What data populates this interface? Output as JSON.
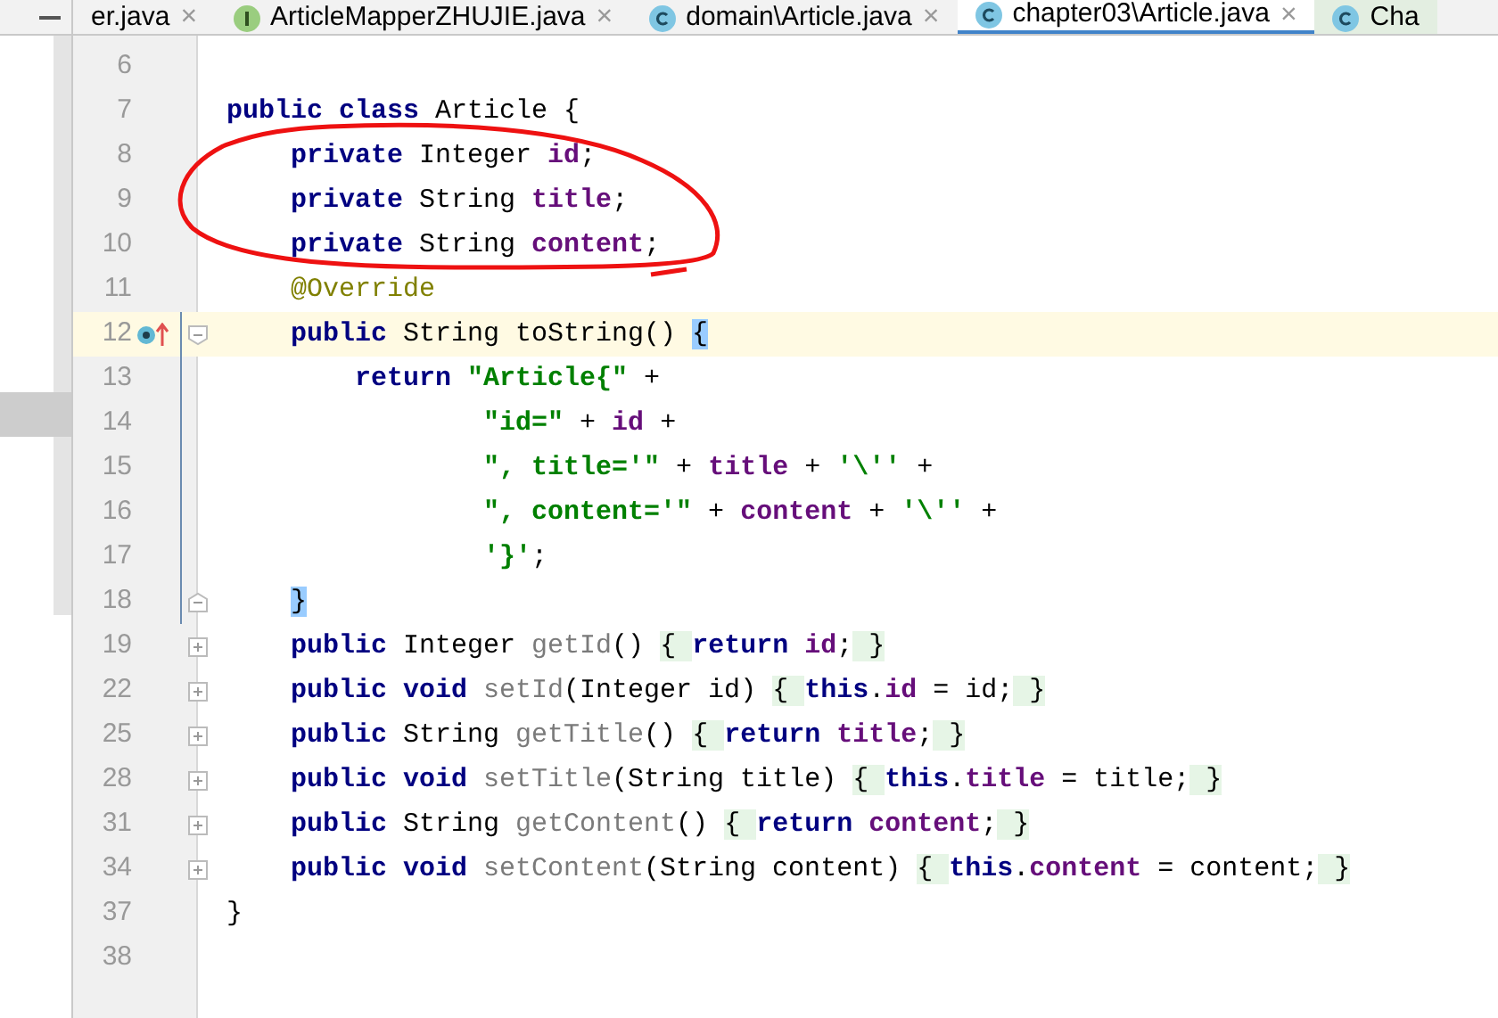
{
  "tabs": [
    {
      "label": "er.java",
      "kind": "plain",
      "selected": false,
      "close": "×"
    },
    {
      "label": "ArticleMapperZHUJIE.java",
      "kind": "interface",
      "selected": false,
      "close": "×"
    },
    {
      "label": "domain\\Article.java",
      "kind": "class",
      "selected": false,
      "close": "×"
    },
    {
      "label": "chapter03\\Article.java",
      "kind": "class",
      "selected": true,
      "close": "×"
    },
    {
      "label": "Cha",
      "kind": "class",
      "selected": false
    }
  ],
  "lines": [
    {
      "number": "6"
    },
    {
      "number": "7",
      "tokens": [
        {
          "text": "public class",
          "kind": "keyword"
        },
        {
          "text": " Article {",
          "kind": "plain"
        }
      ]
    },
    {
      "number": "8",
      "tokens": [
        {
          "text": "    private",
          "kind": "keyword"
        },
        {
          "text": " Integer ",
          "kind": "plain"
        },
        {
          "text": "id",
          "kind": "field"
        },
        {
          "text": ";",
          "kind": "plain"
        }
      ]
    },
    {
      "number": "9",
      "tokens": [
        {
          "text": "    private",
          "kind": "keyword"
        },
        {
          "text": " String ",
          "kind": "plain"
        },
        {
          "text": "title",
          "kind": "field"
        },
        {
          "text": ";",
          "kind": "plain"
        }
      ]
    },
    {
      "number": "10",
      "tokens": [
        {
          "text": "    private",
          "kind": "keyword"
        },
        {
          "text": " String ",
          "kind": "plain"
        },
        {
          "text": "content",
          "kind": "field"
        },
        {
          "text": ";",
          "kind": "plain"
        }
      ]
    },
    {
      "number": "11",
      "tokens": [
        {
          "text": "    @Override",
          "kind": "annotation"
        }
      ]
    },
    {
      "number": "12",
      "current": true,
      "overrides": true,
      "fold_start": true,
      "bar": true,
      "tokens": [
        {
          "text": "    public",
          "kind": "keyword"
        },
        {
          "text": " String toString() ",
          "kind": "plain"
        },
        {
          "text": "{",
          "kind": "match"
        }
      ]
    },
    {
      "number": "13",
      "bar": true,
      "tokens": [
        {
          "text": "        return ",
          "kind": "keyword"
        },
        {
          "text": "\"Article{\"",
          "kind": "string"
        },
        {
          "text": " +",
          "kind": "plain"
        }
      ]
    },
    {
      "number": "14",
      "bar": true,
      "tokens": [
        {
          "text": "                \"id=\"",
          "kind": "string"
        },
        {
          "text": " + ",
          "kind": "plain"
        },
        {
          "text": "id",
          "kind": "field"
        },
        {
          "text": " +",
          "kind": "plain"
        }
      ]
    },
    {
      "number": "15",
      "bar": true,
      "tokens": [
        {
          "text": "                \", title='\"",
          "kind": "string"
        },
        {
          "text": " + ",
          "kind": "plain"
        },
        {
          "text": "title",
          "kind": "field"
        },
        {
          "text": " + ",
          "kind": "plain"
        },
        {
          "text": "'\\''",
          "kind": "string"
        },
        {
          "text": " +",
          "kind": "plain"
        }
      ]
    },
    {
      "number": "16",
      "bar": true,
      "tokens": [
        {
          "text": "                \", content='\"",
          "kind": "string"
        },
        {
          "text": " + ",
          "kind": "plain"
        },
        {
          "text": "content",
          "kind": "field"
        },
        {
          "text": " + ",
          "kind": "plain"
        },
        {
          "text": "'\\''",
          "kind": "string"
        },
        {
          "text": " +",
          "kind": "plain"
        }
      ]
    },
    {
      "number": "17",
      "bar": true,
      "tokens": [
        {
          "text": "                '}'",
          "kind": "string"
        },
        {
          "text": ";",
          "kind": "plain"
        }
      ]
    },
    {
      "number": "18",
      "fold_end": true,
      "bar": true,
      "tokens": [
        {
          "text": "    }",
          "kind": "match"
        }
      ]
    },
    {
      "number": "19",
      "collapsed": true,
      "tokens": [
        {
          "text": "    public",
          "kind": "keyword"
        },
        {
          "text": " Integer ",
          "kind": "plain"
        },
        {
          "text": "getId",
          "kind": "method"
        },
        {
          "text": "() ",
          "kind": "plain"
        },
        {
          "text": "{ ",
          "kind": "folded"
        },
        {
          "text": "return ",
          "kind": "keyword"
        },
        {
          "text": "id",
          "kind": "field"
        },
        {
          "text": ";",
          "kind": "plain"
        },
        {
          "text": " }",
          "kind": "folded"
        }
      ]
    },
    {
      "number": "22",
      "collapsed": true,
      "tokens": [
        {
          "text": "    public void ",
          "kind": "keyword"
        },
        {
          "text": "setId",
          "kind": "method"
        },
        {
          "text": "(Integer id) ",
          "kind": "plain"
        },
        {
          "text": "{ ",
          "kind": "folded"
        },
        {
          "text": "this",
          "kind": "keyword"
        },
        {
          "text": ".",
          "kind": "plain"
        },
        {
          "text": "id",
          "kind": "field"
        },
        {
          "text": " = id;",
          "kind": "plain"
        },
        {
          "text": " }",
          "kind": "folded"
        }
      ]
    },
    {
      "number": "25",
      "collapsed": true,
      "tokens": [
        {
          "text": "    public",
          "kind": "keyword"
        },
        {
          "text": " String ",
          "kind": "plain"
        },
        {
          "text": "getTitle",
          "kind": "method"
        },
        {
          "text": "() ",
          "kind": "plain"
        },
        {
          "text": "{ ",
          "kind": "folded"
        },
        {
          "text": "return ",
          "kind": "keyword"
        },
        {
          "text": "title",
          "kind": "field"
        },
        {
          "text": ";",
          "kind": "plain"
        },
        {
          "text": " }",
          "kind": "folded"
        }
      ]
    },
    {
      "number": "28",
      "collapsed": true,
      "tokens": [
        {
          "text": "    public void ",
          "kind": "keyword"
        },
        {
          "text": "setTitle",
          "kind": "method"
        },
        {
          "text": "(String title) ",
          "kind": "plain"
        },
        {
          "text": "{ ",
          "kind": "folded"
        },
        {
          "text": "this",
          "kind": "keyword"
        },
        {
          "text": ".",
          "kind": "plain"
        },
        {
          "text": "title",
          "kind": "field"
        },
        {
          "text": " = title;",
          "kind": "plain"
        },
        {
          "text": " }",
          "kind": "folded"
        }
      ]
    },
    {
      "number": "31",
      "collapsed": true,
      "tokens": [
        {
          "text": "    public",
          "kind": "keyword"
        },
        {
          "text": " String ",
          "kind": "plain"
        },
        {
          "text": "getContent",
          "kind": "method"
        },
        {
          "text": "() ",
          "kind": "plain"
        },
        {
          "text": "{ ",
          "kind": "folded"
        },
        {
          "text": "return ",
          "kind": "keyword"
        },
        {
          "text": "content",
          "kind": "field"
        },
        {
          "text": ";",
          "kind": "plain"
        },
        {
          "text": " }",
          "kind": "folded"
        }
      ]
    },
    {
      "number": "34",
      "collapsed": true,
      "tokens": [
        {
          "text": "    public void ",
          "kind": "keyword"
        },
        {
          "text": "setContent",
          "kind": "method"
        },
        {
          "text": "(String content) ",
          "kind": "plain"
        },
        {
          "text": "{ ",
          "kind": "folded"
        },
        {
          "text": "this",
          "kind": "keyword"
        },
        {
          "text": ".",
          "kind": "plain"
        },
        {
          "text": "content",
          "kind": "field"
        },
        {
          "text": " = content;",
          "kind": "plain"
        },
        {
          "text": " }",
          "kind": "folded"
        }
      ]
    },
    {
      "number": "37",
      "tokens": [
        {
          "text": "}",
          "kind": "plain"
        }
      ]
    },
    {
      "number": "38"
    }
  ]
}
